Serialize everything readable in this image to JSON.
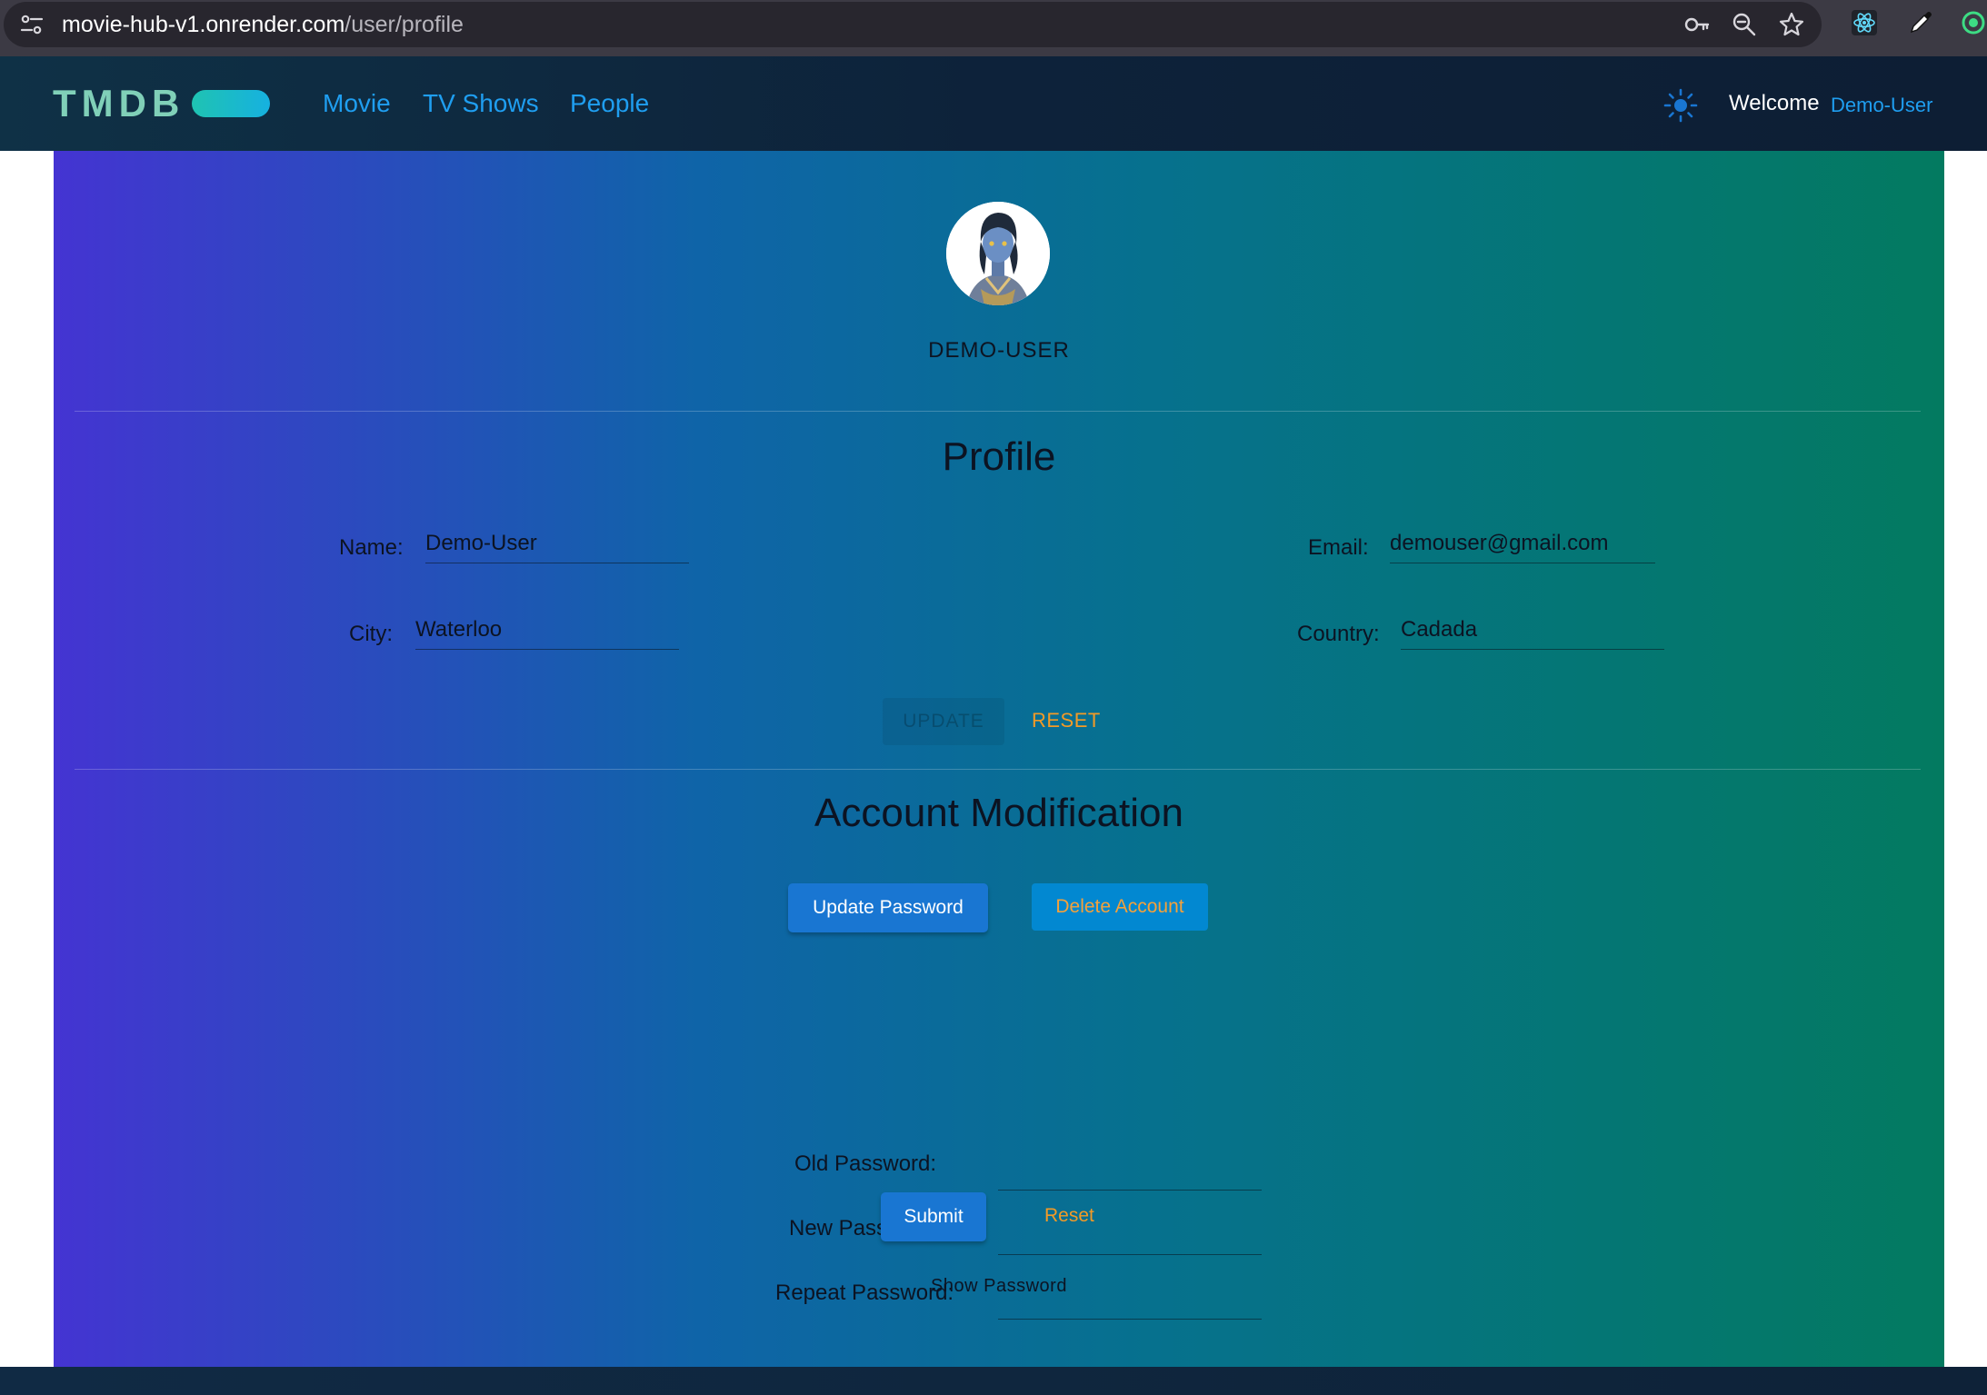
{
  "browser": {
    "url_host": "movie-hub-v1.onrender.com",
    "url_path": "/user/profile",
    "icons": [
      "site-info-icon",
      "key-icon",
      "zoom-icon",
      "bookmark-star-icon",
      "react-devtools-icon",
      "eyedropper-icon",
      "extension-icon"
    ]
  },
  "navbar": {
    "logo_text": "TMDB",
    "links": [
      "Movie",
      "TV Shows",
      "People"
    ],
    "welcome_label": "Welcome",
    "welcome_user": "Demo-User",
    "theme_icon": "sun-icon",
    "accent_color": "#1f9ef0"
  },
  "profile_header": {
    "username": "DEMO-USER",
    "avatar": "user-avatar-image"
  },
  "profile": {
    "title": "Profile",
    "name_label": "Name:",
    "name_value": "Demo-User",
    "email_label": "Email:",
    "email_value": "demouser@gmail.com",
    "city_label": "City:",
    "city_value": "Waterloo",
    "country_label": "Country:",
    "country_value": "Cadada",
    "update_label": "UPDATE",
    "reset_label": "RESET"
  },
  "account": {
    "title": "Account Modification",
    "update_password_label": "Update Password",
    "delete_account_label": "Delete Account",
    "old_password_label": "Old Password:",
    "new_password_label": "New Password:",
    "repeat_password_label": "Repeat Password:",
    "submit_label": "Submit",
    "reset_label": "Reset",
    "show_password_label": "Show Password"
  },
  "colors": {
    "button_blue": "#1976d2",
    "reset_orange": "#f39a26",
    "gradient_start": "#4434d2",
    "gradient_end": "#037a60"
  }
}
